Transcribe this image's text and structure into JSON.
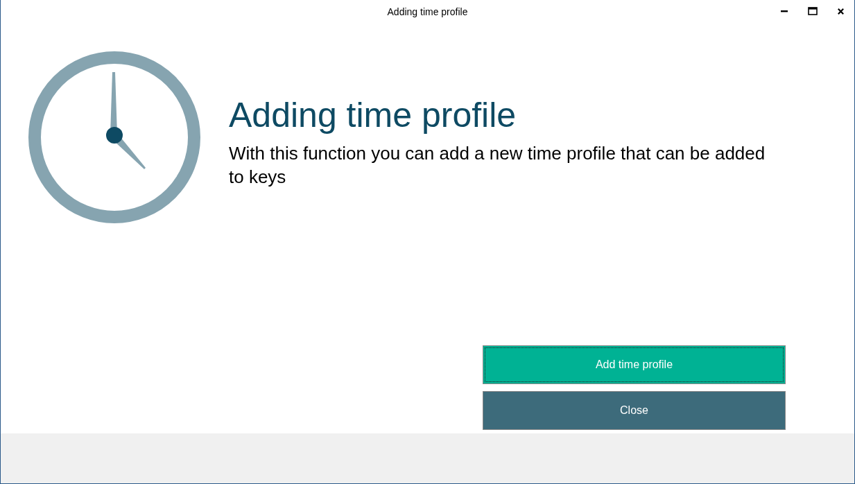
{
  "window": {
    "title": "Adding time profile"
  },
  "heading": "Adding time profile",
  "description": "With this function you can add a new time profile that can be added to keys",
  "buttons": [
    {
      "label": "Add time profile",
      "kind": "primary",
      "focused": true
    },
    {
      "label": "Close",
      "kind": "secondary",
      "focused": false
    }
  ]
}
